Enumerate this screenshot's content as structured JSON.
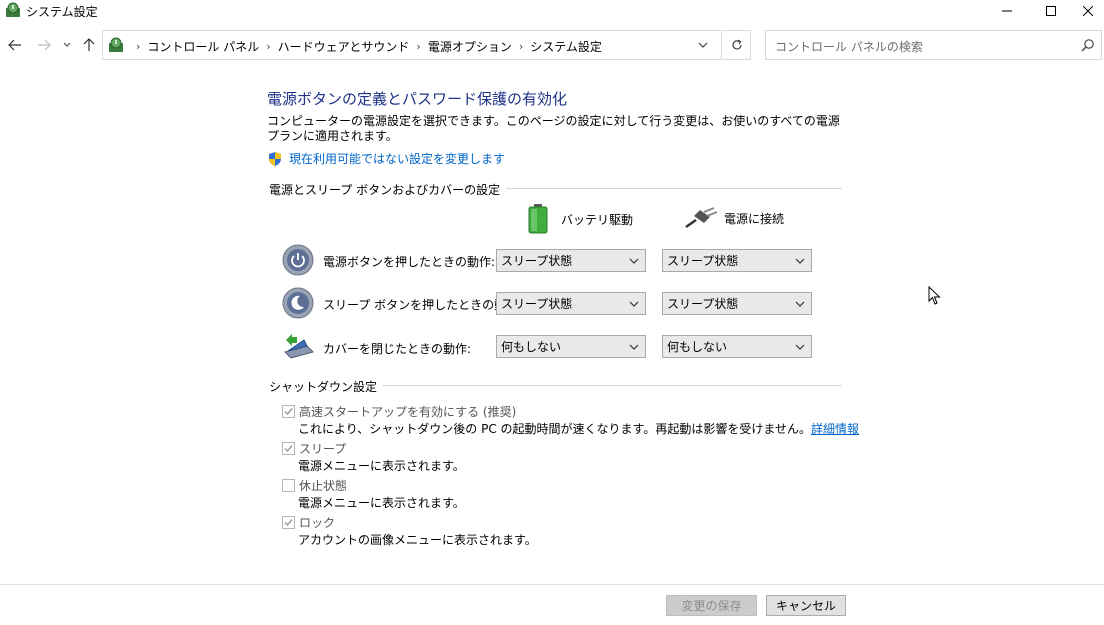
{
  "window": {
    "title": "システム設定",
    "icon": "power-options-icon"
  },
  "address_bar": {
    "crumbs": [
      "コントロール パネル",
      "ハードウェアとサウンド",
      "電源オプション",
      "システム設定"
    ]
  },
  "search": {
    "placeholder": "コントロール パネルの検索"
  },
  "page": {
    "heading": "電源ボタンの定義とパスワード保護の有効化",
    "description": "コンピューターの電源設定を選択できます。このページの設定に対して行う変更は、お使いのすべての電源プランに適用されます。",
    "change_link": "現在利用可能ではない設定を変更します"
  },
  "power_group": {
    "title": "電源とスリープ ボタンおよびカバーの設定",
    "columns": {
      "battery": "バッテリ駆動",
      "plugged": "電源に接続"
    },
    "rows": [
      {
        "label": "電源ボタンを押したときの動作:",
        "battery": "スリープ状態",
        "plugged": "スリープ状態",
        "icon": "power-button-icon"
      },
      {
        "label": "スリープ ボタンを押したときの動作:",
        "battery": "スリープ状態",
        "plugged": "スリープ状態",
        "icon": "sleep-button-icon"
      },
      {
        "label": "カバーを閉じたときの動作:",
        "battery": "何もしない",
        "plugged": "何もしない",
        "icon": "laptop-lid-icon"
      }
    ]
  },
  "shutdown_group": {
    "title": "シャットダウン設定",
    "items": [
      {
        "label": "高速スタートアップを有効にする (推奨)",
        "checked": true,
        "desc": "これにより、シャットダウン後の PC の起動時間が速くなります。再起動は影響を受けません。",
        "link": "詳細情報"
      },
      {
        "label": "スリープ",
        "checked": true,
        "desc": "電源メニューに表示されます。"
      },
      {
        "label": "休止状態",
        "checked": false,
        "desc": "電源メニューに表示されます。"
      },
      {
        "label": "ロック",
        "checked": true,
        "desc": "アカウントの画像メニューに表示されます。"
      }
    ]
  },
  "buttons": {
    "save": "変更の保存",
    "cancel": "キャンセル"
  },
  "colors": {
    "heading": "#1e3287",
    "link": "#0066cc",
    "disabled_text": "#8d8d8d"
  }
}
